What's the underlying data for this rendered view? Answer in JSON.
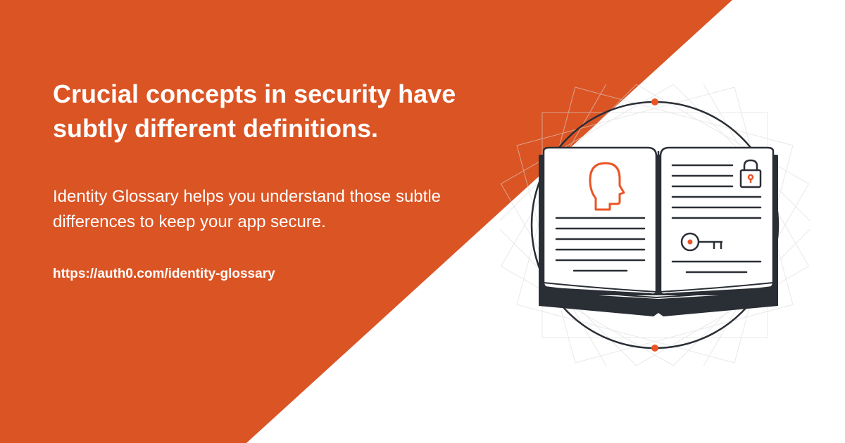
{
  "headline": "Crucial concepts in security have subtly different definitions.",
  "subhead": "Identity Glossary helps you understand those subtle differences to keep your app secure.",
  "url": "https://auth0.com/identity-glossary",
  "colors": {
    "orange": "#DB5424",
    "dark": "#2A2E35",
    "accent": "#EB5424"
  }
}
